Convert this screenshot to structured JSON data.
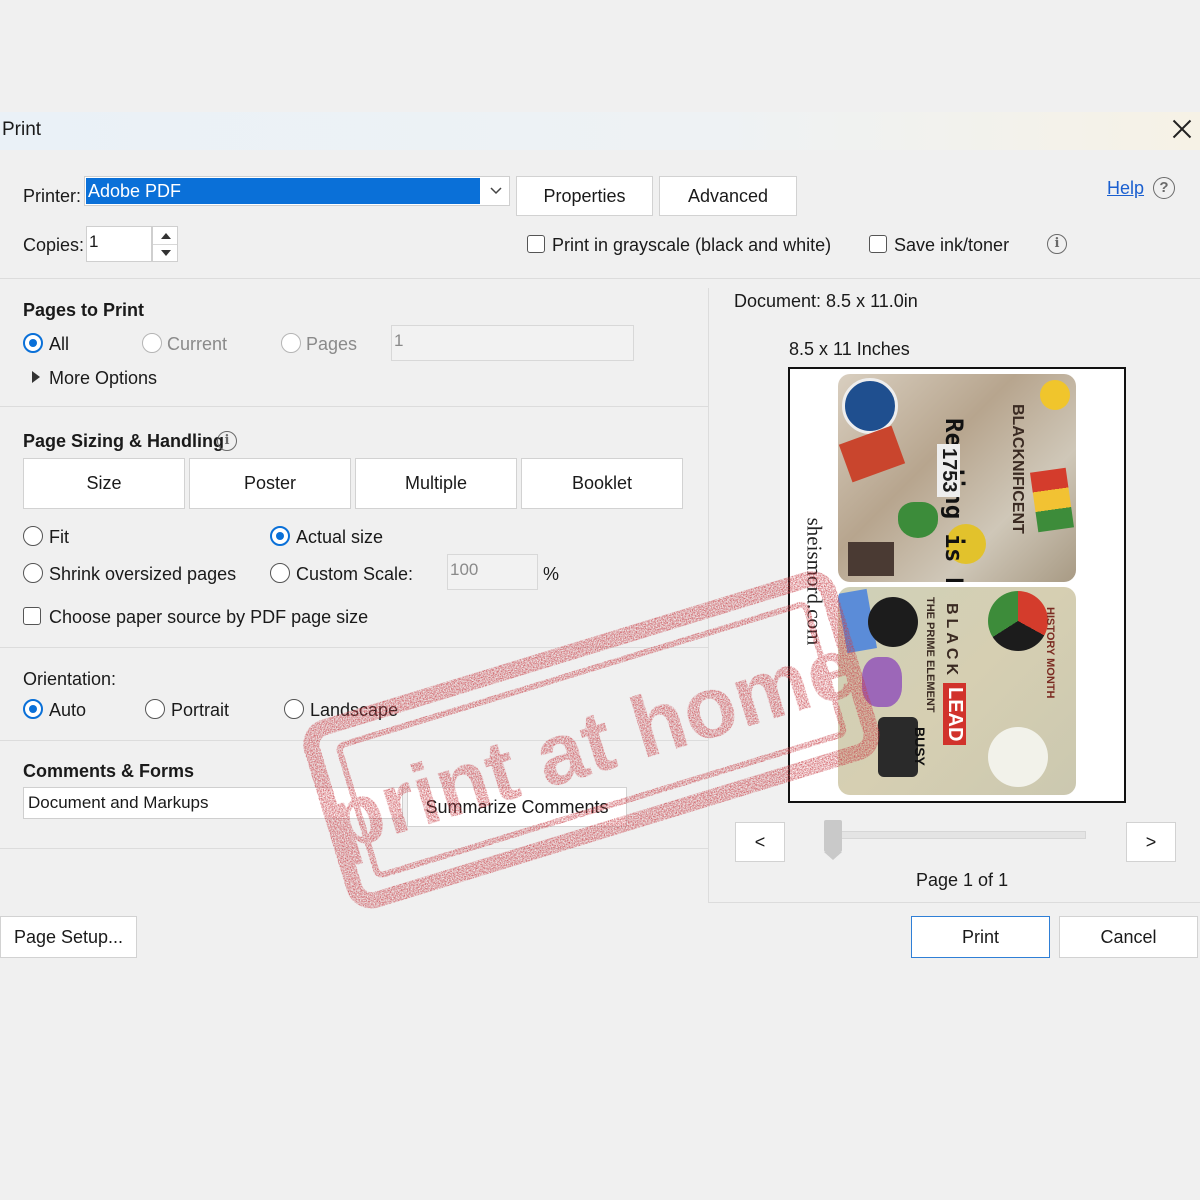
{
  "window": {
    "title": "Print"
  },
  "printer": {
    "label": "Printer:",
    "selected": "Adobe PDF",
    "properties_label": "Properties",
    "advanced_label": "Advanced",
    "help_label": "Help"
  },
  "copies": {
    "label": "Copies:",
    "value": "1",
    "grayscale_label": "Print in grayscale (black and white)",
    "save_ink_label": "Save ink/toner"
  },
  "pages_to_print": {
    "heading": "Pages to Print",
    "all_label": "All",
    "current_label": "Current",
    "pages_label": "Pages",
    "pages_value": "1",
    "more_options_label": "More Options"
  },
  "page_sizing": {
    "heading": "Page Sizing & Handling",
    "tabs": [
      "Size",
      "Poster",
      "Multiple",
      "Booklet"
    ],
    "fit_label": "Fit",
    "actual_size_label": "Actual size",
    "shrink_label": "Shrink oversized pages",
    "custom_scale_label": "Custom Scale:",
    "custom_scale_value": "100",
    "percent": "%",
    "paper_source_label": "Choose paper source by PDF page size"
  },
  "orientation": {
    "heading": "Orientation:",
    "auto_label": "Auto",
    "portrait_label": "Portrait",
    "landscape_label": "Landscape"
  },
  "comments_forms": {
    "heading": "Comments & Forms",
    "selected": "Document and Markups",
    "summarize_label": "Summarize Comments"
  },
  "preview": {
    "document_size": "Document: 8.5 x 11.0in",
    "page_size": "8.5 x 11 Inches",
    "side_text": "sheismord.com",
    "poster_title": "Reading is Power",
    "poster_number": "1753",
    "poster_words": [
      "BLACKNIFICENT",
      "BLACK",
      "LEAD",
      "BUSY",
      "THE PRIME ELEMENT",
      "HISTORY MONTH"
    ],
    "prev_label": "<",
    "next_label": ">",
    "page_indicator": "Page 1 of 1"
  },
  "footer": {
    "page_setup_label": "Page Setup...",
    "print_label": "Print",
    "cancel_label": "Cancel"
  },
  "stamp": {
    "text": "print at home",
    "color": "#c8424a"
  },
  "colors": {
    "accent": "#0a70d8",
    "link": "#1a5fd0"
  }
}
